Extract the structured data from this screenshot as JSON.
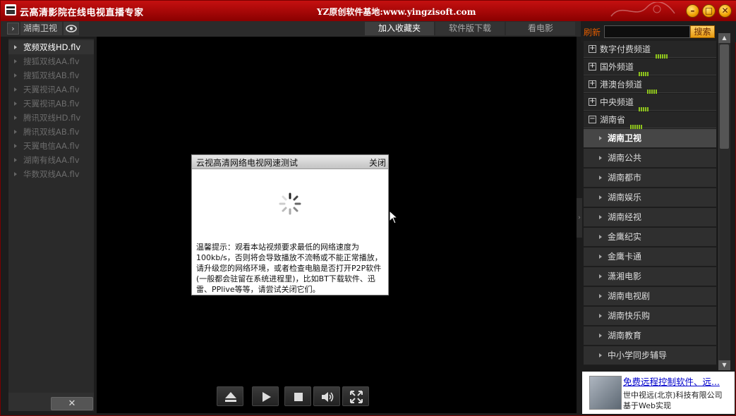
{
  "window": {
    "title": "云高清影院在线电视直播专家",
    "site": "YZ原创软件基地:www.yingzisoft.com"
  },
  "toolbar": {
    "current_channel": "湖南卫视",
    "tabs": [
      {
        "label": "加入收藏夹"
      },
      {
        "label": "软件版下载"
      },
      {
        "label": "看电影"
      }
    ]
  },
  "playlist": {
    "items": [
      {
        "label": "宽频双线HD.flv"
      },
      {
        "label": "搜狐双线AA.flv"
      },
      {
        "label": "搜狐双线AB.flv"
      },
      {
        "label": "天翼视讯AA.flv"
      },
      {
        "label": "天翼视讯AB.flv"
      },
      {
        "label": "腾讯双线HD.flv"
      },
      {
        "label": "腾讯双线AB.flv"
      },
      {
        "label": "天翼电信AA.flv"
      },
      {
        "label": "湖南有线AA.flv"
      },
      {
        "label": "华数双线AA.flv"
      }
    ],
    "close_label": "✕"
  },
  "dialog": {
    "title": "云视高清网络电视网速测试",
    "close_label": "关闭",
    "tip": "温馨提示：观看本站视频要求最低的网络速度为100kb/s，否则将会导致播放不流畅或不能正常播放，请升级您的网络环境，或者检查电脑是否打开P2P软件(一般都会驻留在系统进程里)，比如BT下载软件、迅雷、PPlive等等，请尝试关闭它们。"
  },
  "controls": [
    "eject-icon",
    "play-icon",
    "stop-icon",
    "volume-icon",
    "fullscreen-icon"
  ],
  "right_panel": {
    "refresh_label": "刷新",
    "search_label": "搜索",
    "search_value": "",
    "categories": [
      {
        "label": "数字付费频道",
        "sign": "+"
      },
      {
        "label": "国外频道",
        "sign": "+"
      },
      {
        "label": "港澳台频道",
        "sign": "+"
      },
      {
        "label": "中央频道",
        "sign": "+"
      },
      {
        "label": "湖南省",
        "sign": "−"
      }
    ],
    "channels": [
      {
        "label": "湖南卫视"
      },
      {
        "label": "湖南公共"
      },
      {
        "label": "湖南都市"
      },
      {
        "label": "湖南娱乐"
      },
      {
        "label": "湖南经视"
      },
      {
        "label": "金鹰纪实"
      },
      {
        "label": "金鹰卡通"
      },
      {
        "label": "潇湘电影"
      },
      {
        "label": "湖南电视剧"
      },
      {
        "label": "湖南快乐购"
      },
      {
        "label": "湖南教育"
      },
      {
        "label": "中小学同步辅导"
      }
    ]
  },
  "ad": {
    "title": "免费远程控制软件、远...",
    "line1": "世中视远(北京)科技有限公司",
    "line2": "基于Web实现"
  },
  "colors": {
    "title_bar": "#b00000",
    "accent_orange": "#e25c00",
    "signal_green": "#8ec41c"
  }
}
